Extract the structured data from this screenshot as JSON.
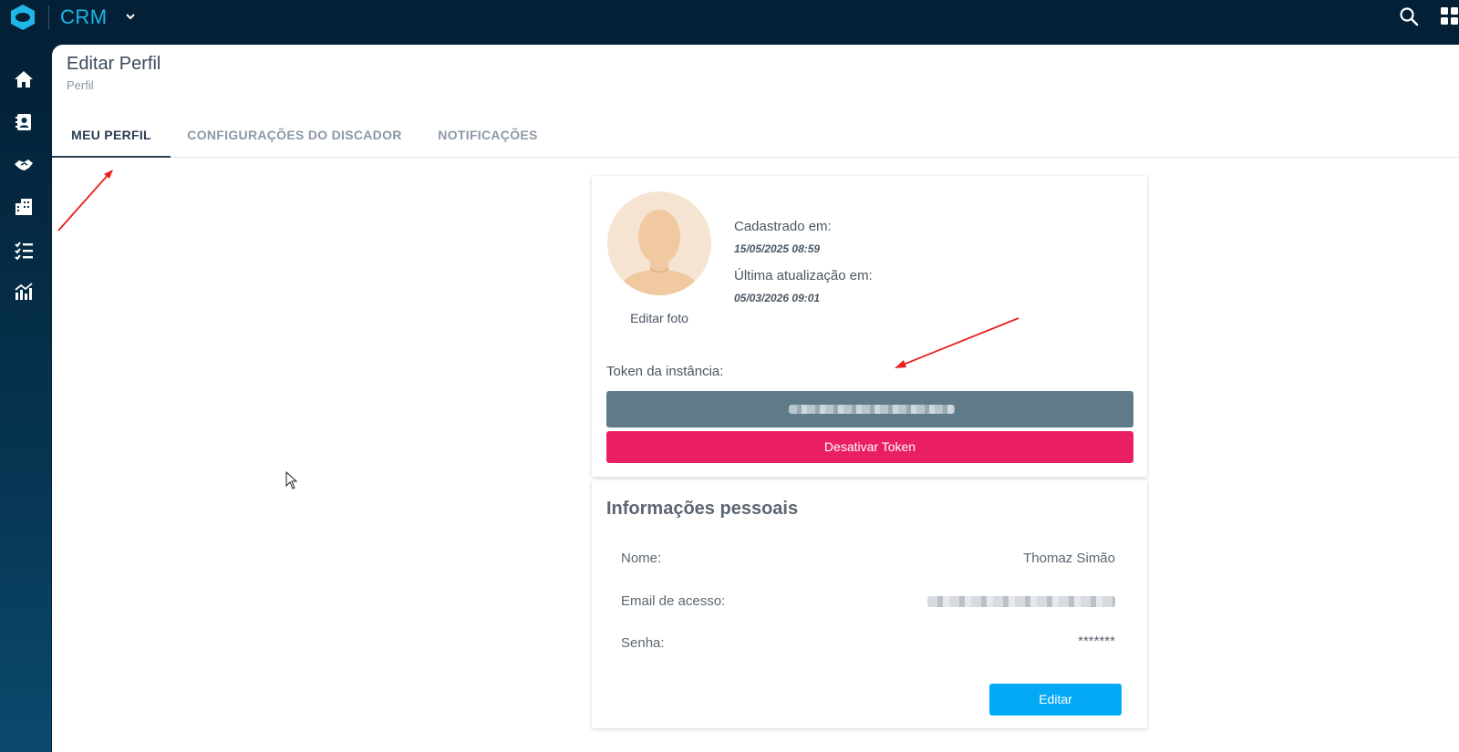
{
  "header": {
    "app_title": "CRM",
    "icons": [
      "logo-icon",
      "chevron-down-icon",
      "search-icon",
      "apps-grid-icon"
    ]
  },
  "sidebar": {
    "items": [
      {
        "icon": "home-icon"
      },
      {
        "icon": "contacts-icon"
      },
      {
        "icon": "handshake-icon"
      },
      {
        "icon": "building-icon"
      },
      {
        "icon": "checklist-icon"
      },
      {
        "icon": "analytics-icon"
      }
    ]
  },
  "page": {
    "title": "Editar Perfil",
    "breadcrumb": "Perfil"
  },
  "tabs": [
    {
      "label": "MEU PERFIL",
      "active": true
    },
    {
      "label": "CONFIGURAÇÕES DO DISCADOR",
      "active": false
    },
    {
      "label": "NOTIFICAÇÕES",
      "active": false
    }
  ],
  "profile": {
    "edit_photo_label": "Editar foto",
    "registered_label": "Cadastrado em:",
    "registered_value": "15/05/2025 08:59",
    "updated_label": "Última atualização em:",
    "updated_value": "05/03/2026 09:01",
    "token_label": "Token da instância:",
    "deactivate_button": "Desativar Token"
  },
  "personal_info": {
    "title": "Informações pessoais",
    "name_label": "Nome:",
    "name_value": "Thomaz Simão",
    "email_label": "Email de acesso:",
    "password_label": "Senha:",
    "password_value": "*******",
    "edit_button": "Editar"
  },
  "colors": {
    "topbar": "#042036",
    "accent": "#1fb6e8",
    "danger": "#e91e63",
    "primary": "#03a9f4",
    "token_bg": "#5f7b8a",
    "annotation_arrow": "#e8211d"
  }
}
